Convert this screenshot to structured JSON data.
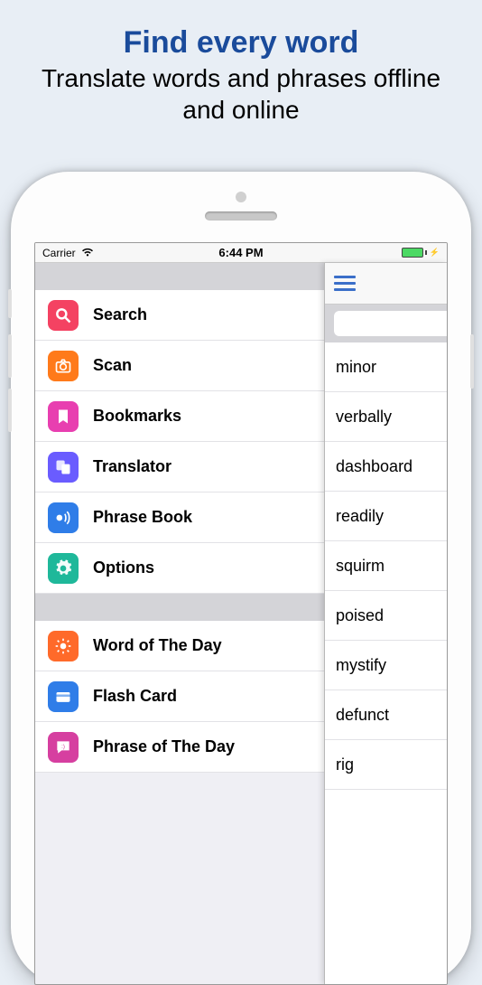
{
  "promo": {
    "title": "Find every word",
    "subtitle": "Translate words and phrases offline and online"
  },
  "statusbar": {
    "carrier": "Carrier",
    "time": "6:44 PM"
  },
  "menu_sections": [
    {
      "items": [
        {
          "key": "search",
          "label": "Search",
          "icon": "search-icon",
          "color": "#f44262"
        },
        {
          "key": "scan",
          "label": "Scan",
          "icon": "camera-icon",
          "color": "#ff7a1a"
        },
        {
          "key": "bookmarks",
          "label": "Bookmarks",
          "icon": "bookmark-icon",
          "color": "#e83fb0"
        },
        {
          "key": "translator",
          "label": "Translator",
          "icon": "translator-icon",
          "color": "#6a5cff"
        },
        {
          "key": "phrasebook",
          "label": "Phrase Book",
          "icon": "speak-icon",
          "color": "#2f7de8"
        },
        {
          "key": "options",
          "label": "Options",
          "icon": "gear-icon",
          "color": "#1fb89a"
        }
      ]
    },
    {
      "items": [
        {
          "key": "wotd",
          "label": "Word of The Day",
          "icon": "sun-icon",
          "color": "#ff6a2a"
        },
        {
          "key": "flashcard",
          "label": "Flash Card",
          "icon": "card-icon",
          "color": "#2f7de8"
        },
        {
          "key": "potd",
          "label": "Phrase of The Day",
          "icon": "bubble-icon",
          "color": "#d63fa0"
        }
      ]
    }
  ],
  "words": [
    "minor",
    "verbally",
    "dashboard",
    "readily",
    "squirm",
    "poised",
    "mystify",
    "defunct",
    "rig"
  ]
}
